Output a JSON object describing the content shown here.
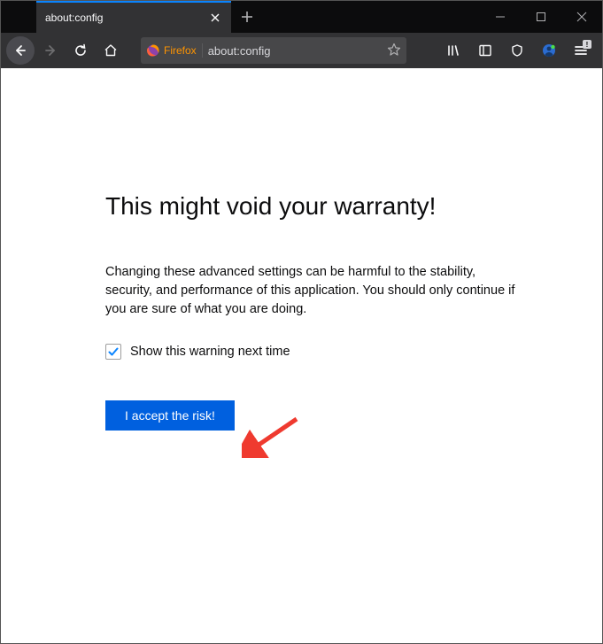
{
  "tab": {
    "title": "about:config"
  },
  "identity": {
    "label": "Firefox"
  },
  "url": {
    "text": "about:config"
  },
  "warning": {
    "title": "This might void your warranty!",
    "body": "Changing these advanced settings can be harmful to the stability, security, and performance of this application. You should only continue if you are sure of what you are doing.",
    "checkbox_label": "Show this warning next time",
    "accept_label": "I accept the risk!"
  }
}
